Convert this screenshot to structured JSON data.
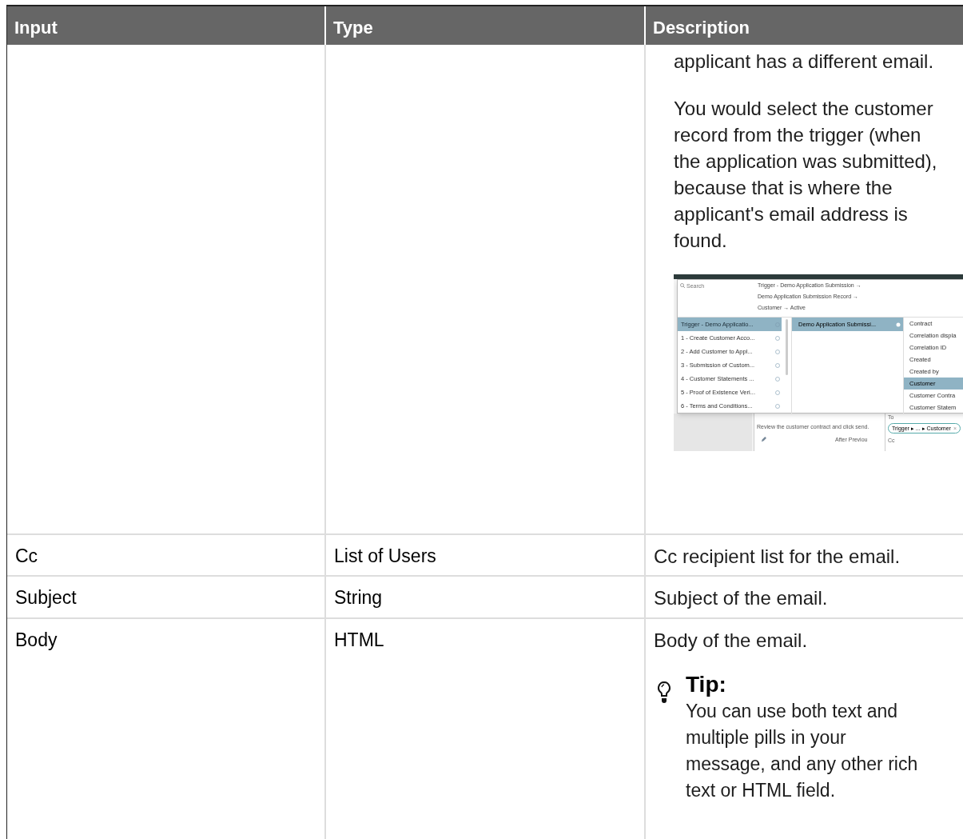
{
  "table": {
    "columns": [
      "Input",
      "Type",
      "Description"
    ],
    "rows": [
      {
        "description": {
          "paragraphs": [
            "applicant has a different email.",
            "You would select the customer record from the trigger (when the application was submitted), because that is where the applicant's email address is found."
          ],
          "screenshot": {
            "search_placeholder": "Search",
            "breadcrumb": [
              "Trigger - Demo Application Submission →",
              "Demo Application Submission Record →",
              "Customer → Active"
            ],
            "steps": [
              {
                "label": "Trigger - Demo Applicatio...",
                "selected": true
              },
              {
                "label": "1 - Create Customer Acco...",
                "selected": false
              },
              {
                "label": "2 - Add Customer to Appl...",
                "selected": false
              },
              {
                "label": "3 - Submission of Custom...",
                "selected": false
              },
              {
                "label": "4 - Customer Statements ...",
                "selected": false
              },
              {
                "label": "5 - Proof of Existence Veri...",
                "selected": false
              },
              {
                "label": "6 - Terms and Conditions...",
                "selected": false
              }
            ],
            "records": [
              {
                "label": "Demo Application Submissi...",
                "selected": true
              }
            ],
            "fields": [
              {
                "label": "Contract",
                "selected": false
              },
              {
                "label": "Correlation displa",
                "selected": false
              },
              {
                "label": "Correlation ID",
                "selected": false
              },
              {
                "label": "Created",
                "selected": false
              },
              {
                "label": "Created by",
                "selected": false
              },
              {
                "label": "Customer",
                "selected": true
              },
              {
                "label": "Customer Contra",
                "selected": false
              },
              {
                "label": "Customer Statem",
                "selected": false
              }
            ],
            "instruction": "Review the customer contract and click send.",
            "after": "After Previou",
            "to_label": "To",
            "recipient_pill": "Trigger ▸ ... ▸ Customer",
            "pill_remove": "×",
            "cc_label": "Cc"
          }
        }
      },
      {
        "input": "Cc",
        "type": "List of Users",
        "description": {
          "paragraphs": [
            "Cc recipient list for the email."
          ]
        }
      },
      {
        "input": "Subject",
        "type": "String",
        "description": {
          "paragraphs": [
            "Subject of the email."
          ]
        }
      },
      {
        "input": "Body",
        "type": "HTML",
        "description": {
          "paragraphs": [
            "Body of the email."
          ],
          "tip": {
            "title": "Tip:",
            "text": "You can use both text and multiple pills in your message, and any other rich text or HTML field."
          }
        }
      }
    ]
  }
}
